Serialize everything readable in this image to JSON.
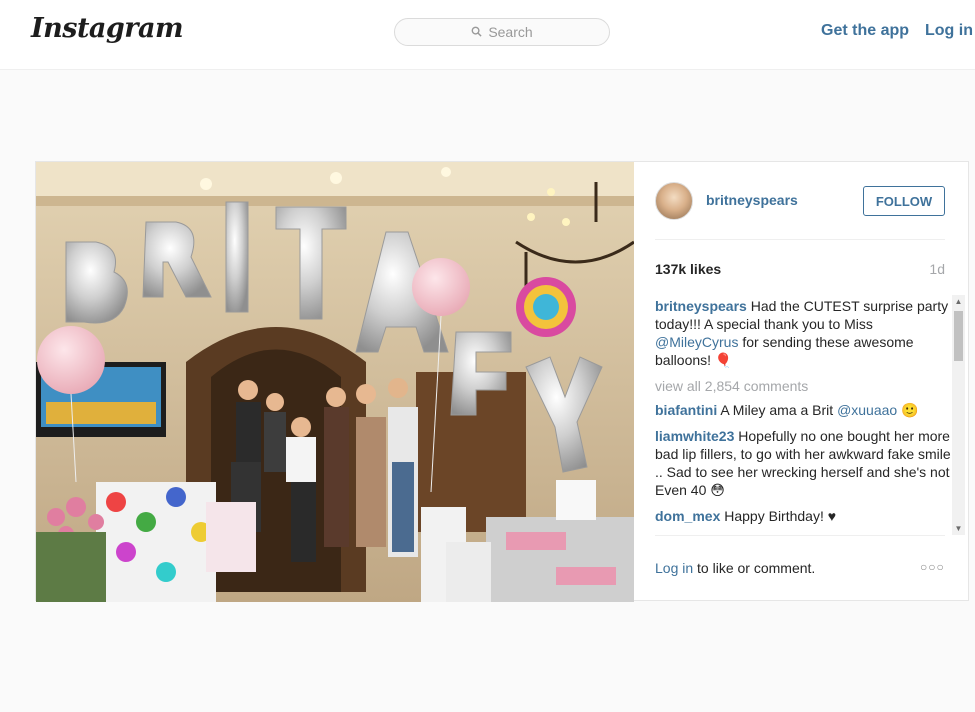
{
  "header": {
    "logo_text": "Instagram",
    "search_placeholder": "Search",
    "get_app_label": "Get the app",
    "login_label": "Log in"
  },
  "post": {
    "username": "britneyspears",
    "follow_label": "FOLLOW",
    "likes": "137k likes",
    "age": "1d",
    "caption_user": "britneyspears",
    "caption_text_1": " Had the CUTEST surprise party today!!! A special thank you to Miss ",
    "caption_mention": "@MileyCyrus",
    "caption_text_2": " for sending these awesome balloons! 🎈",
    "view_all": "view all 2,854 comments",
    "comments": [
      {
        "user": "biafantini",
        "text": " A Miley ama a Brit ",
        "mention": "@xuuaao",
        "suffix": " 🙂"
      },
      {
        "user": "liamwhite23",
        "text": " Hopefully no one bought her more bad lip fillers, to go with her awkward fake smile .. Sad to see her wrecking herself and she's not Even 40 😳",
        "mention": "",
        "suffix": ""
      },
      {
        "user": "dom_mex",
        "text": " Happy Birthday! ♥",
        "mention": "",
        "suffix": ""
      }
    ],
    "footer_login": "Log in",
    "footer_text": " to like or comment.",
    "more_label": "○○○"
  },
  "icons": [
    "search-icon",
    "scroll-up-icon",
    "scroll-down-icon",
    "more-options-icon"
  ]
}
